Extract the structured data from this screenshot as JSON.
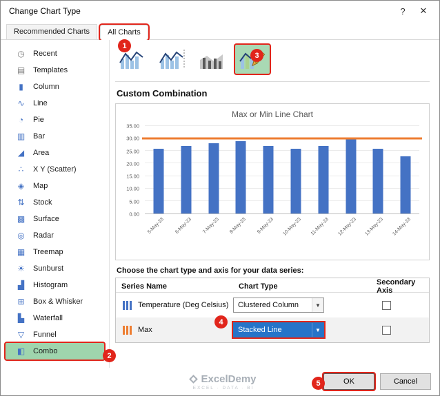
{
  "dialog": {
    "title": "Change Chart Type",
    "help_icon": "?",
    "close_icon": "✕"
  },
  "tabs": [
    {
      "label": "Recommended Charts",
      "active": false
    },
    {
      "label": "All Charts",
      "active": true,
      "annotated": true
    }
  ],
  "sidebar": {
    "items": [
      {
        "label": "Recent",
        "icon": "recent-icon",
        "glyph": "◷"
      },
      {
        "label": "Templates",
        "icon": "templates-icon",
        "glyph": "▤"
      },
      {
        "label": "Column",
        "icon": "column-chart-icon",
        "glyph": "▮"
      },
      {
        "label": "Line",
        "icon": "line-chart-icon",
        "glyph": "∿"
      },
      {
        "label": "Pie",
        "icon": "pie-chart-icon",
        "glyph": "◔"
      },
      {
        "label": "Bar",
        "icon": "bar-chart-icon",
        "glyph": "▥"
      },
      {
        "label": "Area",
        "icon": "area-chart-icon",
        "glyph": "◢"
      },
      {
        "label": "X Y (Scatter)",
        "icon": "scatter-chart-icon",
        "glyph": "∴"
      },
      {
        "label": "Map",
        "icon": "map-chart-icon",
        "glyph": "◈"
      },
      {
        "label": "Stock",
        "icon": "stock-chart-icon",
        "glyph": "⇅"
      },
      {
        "label": "Surface",
        "icon": "surface-chart-icon",
        "glyph": "▩"
      },
      {
        "label": "Radar",
        "icon": "radar-chart-icon",
        "glyph": "◎"
      },
      {
        "label": "Treemap",
        "icon": "treemap-chart-icon",
        "glyph": "▦"
      },
      {
        "label": "Sunburst",
        "icon": "sunburst-chart-icon",
        "glyph": "☀"
      },
      {
        "label": "Histogram",
        "icon": "histogram-chart-icon",
        "glyph": "▟"
      },
      {
        "label": "Box & Whisker",
        "icon": "box-whisker-chart-icon",
        "glyph": "⊞"
      },
      {
        "label": "Waterfall",
        "icon": "waterfall-chart-icon",
        "glyph": "▙"
      },
      {
        "label": "Funnel",
        "icon": "funnel-chart-icon",
        "glyph": "▽"
      },
      {
        "label": "Combo",
        "icon": "combo-chart-icon",
        "glyph": "◧",
        "selected": true,
        "annotated": true
      }
    ]
  },
  "subtypes": {
    "icons": [
      {
        "name": "clustered-column-line-icon"
      },
      {
        "name": "clustered-column-line-secondary-axis-icon"
      },
      {
        "name": "stacked-area-clustered-column-icon"
      },
      {
        "name": "custom-combination-icon",
        "selected": true,
        "annotated": true
      }
    ]
  },
  "content": {
    "section_title": "Custom Combination",
    "series_prompt": "Choose the chart type and axis for your data series:"
  },
  "chart_data": {
    "type": "bar",
    "title": "Max or Min Line Chart",
    "categories": [
      "5-May-23",
      "6-May-23",
      "7-May-23",
      "8-May-23",
      "9-May-23",
      "10-May-23",
      "11-May-23",
      "12-May-23",
      "13-May-23",
      "14-May-23"
    ],
    "series": [
      {
        "name": "Temperature (Deg Celsius)",
        "type": "clustered-column",
        "color": "#4472C4",
        "values": [
          26,
          27,
          28,
          29,
          27,
          26,
          27,
          30,
          26,
          23
        ]
      },
      {
        "name": "Max",
        "type": "stacked-line",
        "color": "#ED7D31",
        "values": [
          30,
          30,
          30,
          30,
          30,
          30,
          30,
          30,
          30,
          30
        ]
      }
    ],
    "ylim": [
      0,
      35
    ],
    "ytick_step": 5,
    "grid": true,
    "legend": false
  },
  "series_table": {
    "headers": [
      "Series Name",
      "Chart Type",
      "Secondary Axis"
    ],
    "rows": [
      {
        "series": "Temperature (Deg Celsius)",
        "swatch": "#4472C4",
        "chart_type": "Clustered Column",
        "secondary_axis": false,
        "selected": false,
        "annotated": false
      },
      {
        "series": "Max",
        "swatch": "#ED7D31",
        "chart_type": "Stacked Line",
        "secondary_axis": false,
        "selected": true,
        "annotated": true
      }
    ]
  },
  "footer": {
    "ok_label": "OK",
    "cancel_label": "Cancel",
    "watermark": {
      "name": "ExcelDemy",
      "tagline": "EXCEL · DATA · BI"
    }
  },
  "annotations": {
    "color": "#e1251b",
    "steps": [
      "1",
      "2",
      "3",
      "4",
      "5"
    ]
  }
}
